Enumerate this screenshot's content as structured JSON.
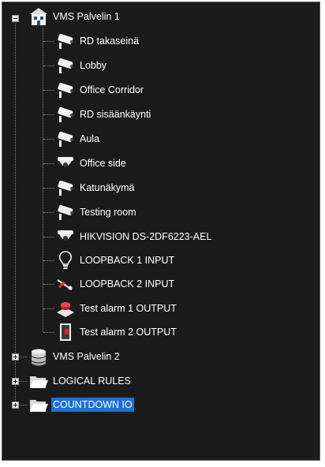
{
  "tree": {
    "server1": {
      "label": "VMS Palvelin 1",
      "icon": "server-building-icon",
      "expanded": true,
      "children": [
        {
          "label": "RD takaseinä",
          "icon": "bullet-camera-icon"
        },
        {
          "label": "Lobby",
          "icon": "bullet-camera-icon"
        },
        {
          "label": "Office Corridor",
          "icon": "bullet-camera-icon"
        },
        {
          "label": "RD sisäänkäynti",
          "icon": "bullet-camera-icon"
        },
        {
          "label": "Aula",
          "icon": "bullet-camera-icon"
        },
        {
          "label": "Office side",
          "icon": "dome-camera-icon"
        },
        {
          "label": "Katunäkymä",
          "icon": "bullet-camera-icon"
        },
        {
          "label": "Testing room",
          "icon": "bullet-camera-icon"
        },
        {
          "label": "HIKVISION DS-2DF6223-AEL",
          "icon": "dome-camera-icon"
        },
        {
          "label": "LOOPBACK 1 INPUT",
          "icon": "lightbulb-icon"
        },
        {
          "label": "LOOPBACK 2 INPUT",
          "icon": "switch-input-icon"
        },
        {
          "label": "Test alarm 1 OUTPUT",
          "icon": "alarm-button-icon"
        },
        {
          "label": "Test alarm 2 OUTPUT",
          "icon": "door-output-icon"
        }
      ]
    },
    "server2": {
      "label": "VMS Palvelin 2",
      "icon": "server-stack-icon",
      "expanded": false
    },
    "logical_rules": {
      "label": "LOGICAL RULES",
      "icon": "folder-icon",
      "expanded": false
    },
    "countdown_io": {
      "label": "COUNTDOWN IO",
      "icon": "folder-icon",
      "expanded": false,
      "selected": true
    }
  },
  "colors": {
    "background": "#1b1b1b",
    "text": "#ffffff",
    "selection": "#1e6fd9",
    "tree_lines": "#8a8a8a"
  }
}
